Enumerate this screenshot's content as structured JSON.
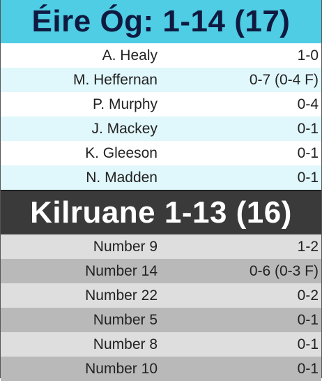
{
  "home": {
    "title": "Éire Óg: 1-14 (17)",
    "scorers": [
      {
        "name": "A. Healy",
        "score": "1-0"
      },
      {
        "name": "M. Heffernan",
        "score": "0-7 (0-4 F)"
      },
      {
        "name": "P. Murphy",
        "score": "0-4"
      },
      {
        "name": "J. Mackey",
        "score": "0-1"
      },
      {
        "name": "K. Gleeson",
        "score": "0-1"
      },
      {
        "name": "N. Madden",
        "score": "0-1"
      }
    ],
    "colors": {
      "header_bg": "#4ecde4",
      "header_text": "#101a40",
      "row_alt": "#e0f7fb"
    }
  },
  "away": {
    "title": "Kilruane 1-13 (16)",
    "scorers": [
      {
        "name": "Number 9",
        "score": "1-2"
      },
      {
        "name": "Number 14",
        "score": "0-6 (0-3 F)"
      },
      {
        "name": "Number 22",
        "score": "0-2"
      },
      {
        "name": "Number 5",
        "score": "0-1"
      },
      {
        "name": "Number 8",
        "score": "0-1"
      },
      {
        "name": "Number 10",
        "score": "0-1"
      }
    ],
    "colors": {
      "header_bg": "#3a3a3a",
      "header_text": "#ffffff",
      "row_light": "#dedede",
      "row_dark": "#b9b9b9"
    }
  }
}
